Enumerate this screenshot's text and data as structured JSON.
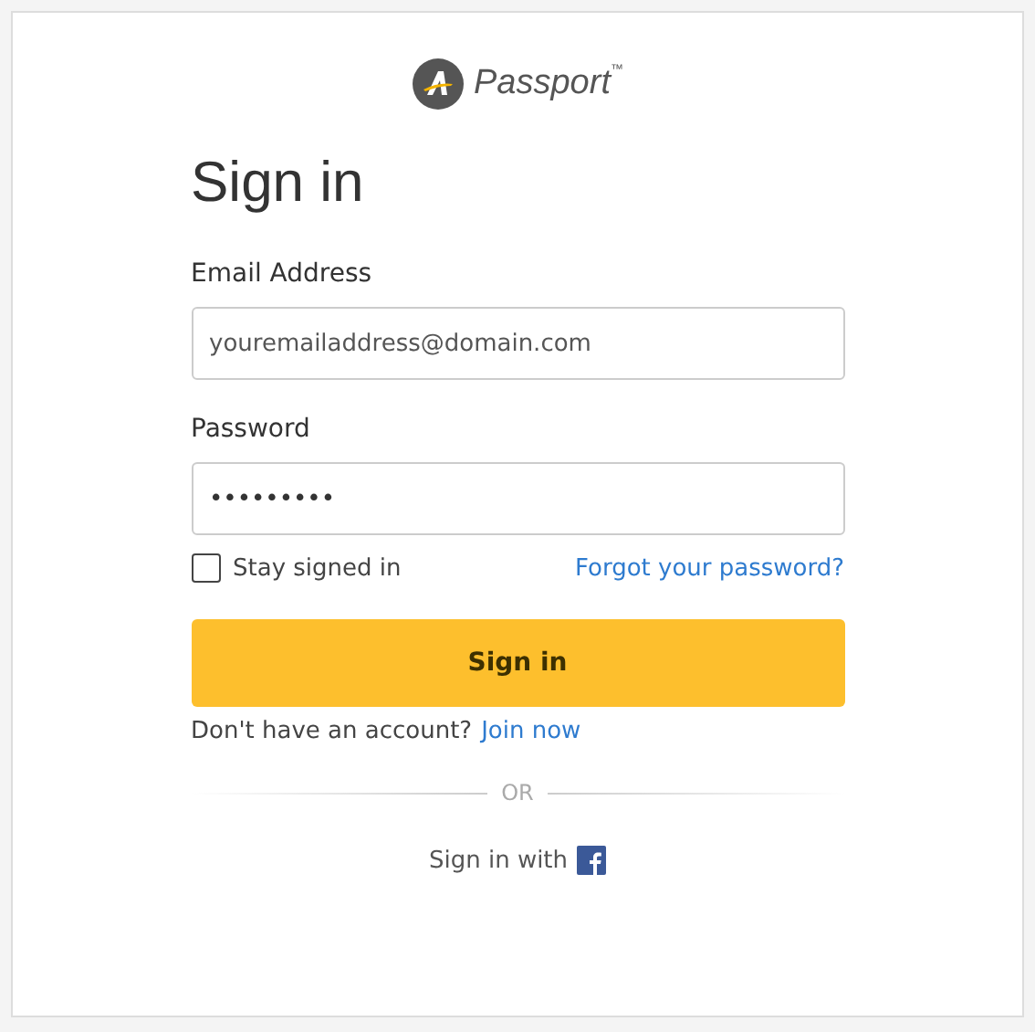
{
  "logo": {
    "name": "Passport",
    "trademark": "™"
  },
  "title": "Sign in",
  "email": {
    "label": "Email Address",
    "placeholder": "youremailaddress@domain.com"
  },
  "password": {
    "label": "Password",
    "value": "•••••••••"
  },
  "stay_signed_in": {
    "label": "Stay signed in",
    "checked": false
  },
  "forgot_link": "Forgot your password?",
  "submit": "Sign in",
  "signup": {
    "text": "Don't have an account?",
    "link": "Join now"
  },
  "divider": "OR",
  "social": {
    "text": "Sign in with"
  }
}
